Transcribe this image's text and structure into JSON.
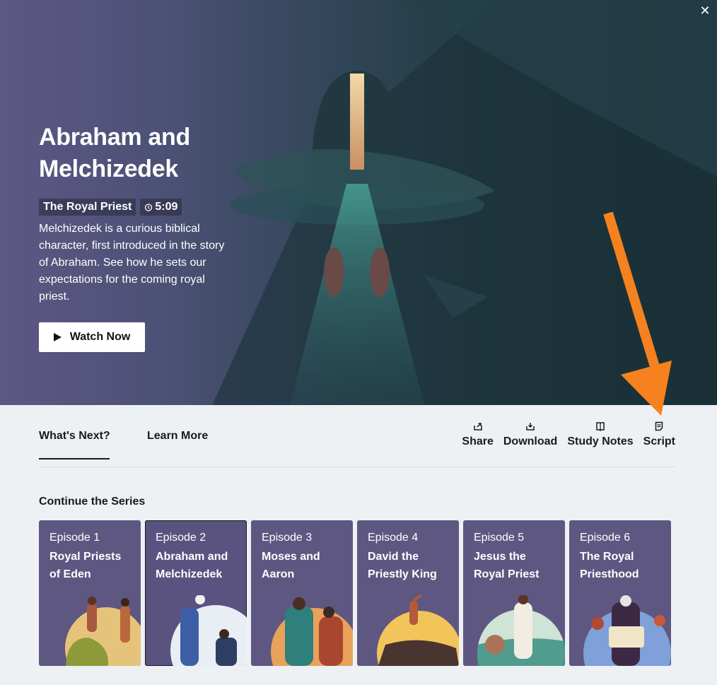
{
  "hero": {
    "title": "Abraham and Melchizedek",
    "series_badge": "The Royal Priest",
    "duration": "5:09",
    "description": "Melchizedek is a curious biblical character, first introduced in the story of Abraham. See how he sets our expectations for the coming royal priest.",
    "watch_label": "Watch Now",
    "close_icon": "close-icon"
  },
  "tabs": [
    {
      "label": "What's Next?"
    },
    {
      "label": "Learn More"
    }
  ],
  "actions": [
    {
      "label": "Share",
      "icon": "share-icon"
    },
    {
      "label": "Download",
      "icon": "download-icon"
    },
    {
      "label": "Study Notes",
      "icon": "study-notes-icon"
    },
    {
      "label": "Script",
      "icon": "script-icon"
    }
  ],
  "series": {
    "title": "Continue the Series",
    "episodes": [
      {
        "episode": "Episode 1",
        "name": "Royal Priests of Eden"
      },
      {
        "episode": "Episode 2",
        "name": "Abraham and Melchizedek"
      },
      {
        "episode": "Episode 3",
        "name": "Moses and Aaron"
      },
      {
        "episode": "Episode 4",
        "name": "David the Priestly King"
      },
      {
        "episode": "Episode 5",
        "name": "Jesus the Royal Priest"
      },
      {
        "episode": "Episode 6",
        "name": "The Royal Priesthood"
      }
    ]
  },
  "colors": {
    "card_bg": "#5e5781",
    "annotation_arrow": "#f5821f",
    "page_bg": "#eef1f4"
  }
}
